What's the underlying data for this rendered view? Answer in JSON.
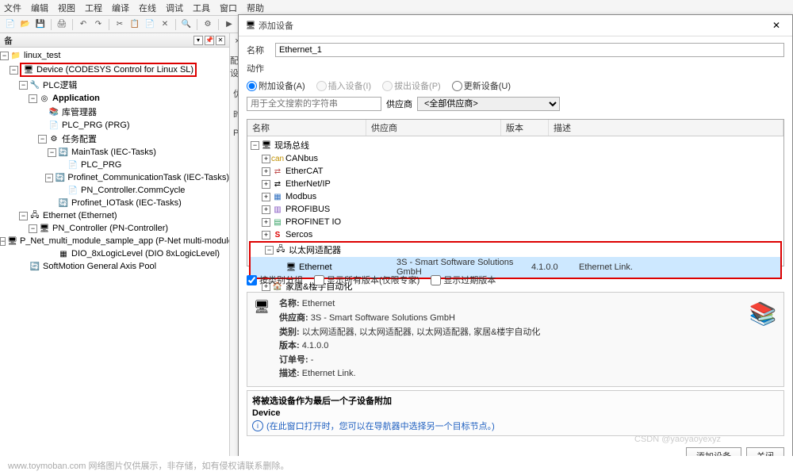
{
  "menu": [
    "文件",
    "编辑",
    "视图",
    "工程",
    "编译",
    "在线",
    "调试",
    "工具",
    "窗口",
    "帮助"
  ],
  "sidebar": {
    "title": "备",
    "root": "linux_test",
    "device": "Device (CODESYS Control for Linux SL)",
    "items": {
      "plc_logic": "PLC逻辑",
      "application": "Application",
      "lib_mgr": "库管理器",
      "plc_prg": "PLC_PRG (PRG)",
      "task_cfg": "任务配置",
      "maintask": "MainTask (IEC-Tasks)",
      "plc_prg2": "PLC_PRG",
      "profinet_comm": "Profinet_CommunicationTask (IEC-Tasks)",
      "pn_ctrl_comm": "PN_Controller.CommCycle",
      "profinet_io": "Profinet_IOTask (IEC-Tasks)",
      "ethernet": "Ethernet (Ethernet)",
      "pn_controller": "PN_Controller (PN-Controller)",
      "pnet_multi": "P_Net_multi_module_sample_app (P-Net multi-module sample a",
      "dio": "DIO_8xLogicLevel (DIO 8xLogicLevel)",
      "softmotion": "SoftMotion General Axis Pool"
    }
  },
  "center": {
    "a": "×",
    "b": "配设",
    "c": "优",
    "d": "时",
    "e": "P("
  },
  "dialog": {
    "title": "添加设备",
    "name_label": "名称",
    "name_value": "Ethernet_1",
    "action_label": "动作",
    "radios": {
      "append": "附加设备(A)",
      "insert": "插入设备(I)",
      "plug": "拔出设备(P)",
      "update": "更新设备(U)"
    },
    "search_ph": "用于全文搜索的字符串",
    "vendor_label": "供应商",
    "vendor_value": "<全部供应商>",
    "cols": {
      "name": "名称",
      "vendor": "供应商",
      "version": "版本",
      "desc": "描述"
    },
    "tree": {
      "fieldbus": "现场总线",
      "canbus": "CANbus",
      "ethercat": "EtherCAT",
      "ethernetip": "EtherNet/IP",
      "modbus": "Modbus",
      "profibus": "PROFIBUS",
      "profinet_io": "PROFINET IO",
      "sercos": "Sercos",
      "eth_adapter": "以太网适配器",
      "ethernet": "Ethernet",
      "ethernet_vendor": "3S - Smart Software Solutions GmbH",
      "ethernet_ver": "4.1.0.0",
      "ethernet_desc": "Ethernet Link.",
      "home": "家居&楼宇自动化"
    },
    "group_chk": "按类别分组",
    "showall_chk": "显示所有版本(仅限专家)",
    "showold_chk": "显示过期版本",
    "detail": {
      "name_lbl": "名称:",
      "name_val": "Ethernet",
      "vendor_lbl": "供应商:",
      "vendor_val": "3S - Smart Software Solutions GmbH",
      "cat_lbl": "类别:",
      "cat_val": "以太网适配器, 以太网适配器, 以太网适配器, 家居&楼宇自动化",
      "ver_lbl": "版本:",
      "ver_val": "4.1.0.0",
      "order_lbl": "订单号:",
      "order_val": "-",
      "desc_lbl": "描述:",
      "desc_val": "Ethernet Link."
    },
    "append_box": {
      "title": "将被选设备作为最后一个子设备附加",
      "device": "Device",
      "info": "(在此窗口打开时，您可以在导航器中选择另一个目标节点。)"
    },
    "btn_add": "添加设备",
    "btn_close": "关闭"
  },
  "footer": "www.toymoban.com 网络图片仅供展示，非存储，如有侵权请联系删除。",
  "watermark": "CSDN @yaoyaoyexyz"
}
